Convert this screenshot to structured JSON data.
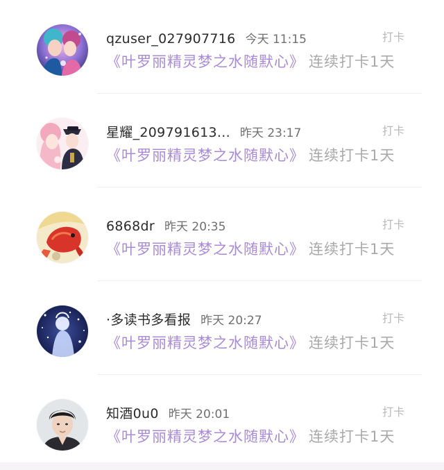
{
  "feed": {
    "items": [
      {
        "username": "qzuser_027907716",
        "time": "今天 11:15",
        "tag": "打卡",
        "book": "《叶罗丽精灵梦之水随默心》",
        "streak": "连续打卡1天",
        "avatar_icon": "anime-couple-avatar"
      },
      {
        "username": "星耀_209791613...",
        "time": "昨天 23:17",
        "tag": "打卡",
        "book": "《叶罗丽精灵梦之水随默心》",
        "streak": "连续打卡1天",
        "avatar_icon": "anime-couple-avatar"
      },
      {
        "username": "6868dr",
        "time": "昨天 20:35",
        "tag": "打卡",
        "book": "《叶罗丽精灵梦之水随默心》",
        "streak": "连续打卡1天",
        "avatar_icon": "koi-fish-avatar"
      },
      {
        "username": "·多读书多看报",
        "time": "昨天 20:27",
        "tag": "打卡",
        "book": "《叶罗丽精灵梦之水随默心》",
        "streak": "连续打卡1天",
        "avatar_icon": "ice-princess-avatar"
      },
      {
        "username": "知酒0u0",
        "time": "昨天 20:01",
        "tag": "打卡",
        "book": "《叶罗丽精灵梦之水随默心》",
        "streak": "连续打卡1天",
        "avatar_icon": "portrait-avatar"
      }
    ]
  },
  "colors": {
    "book_title": "#a98ad6",
    "username": "#2b2b2b",
    "muted": "#a9a9a9"
  }
}
